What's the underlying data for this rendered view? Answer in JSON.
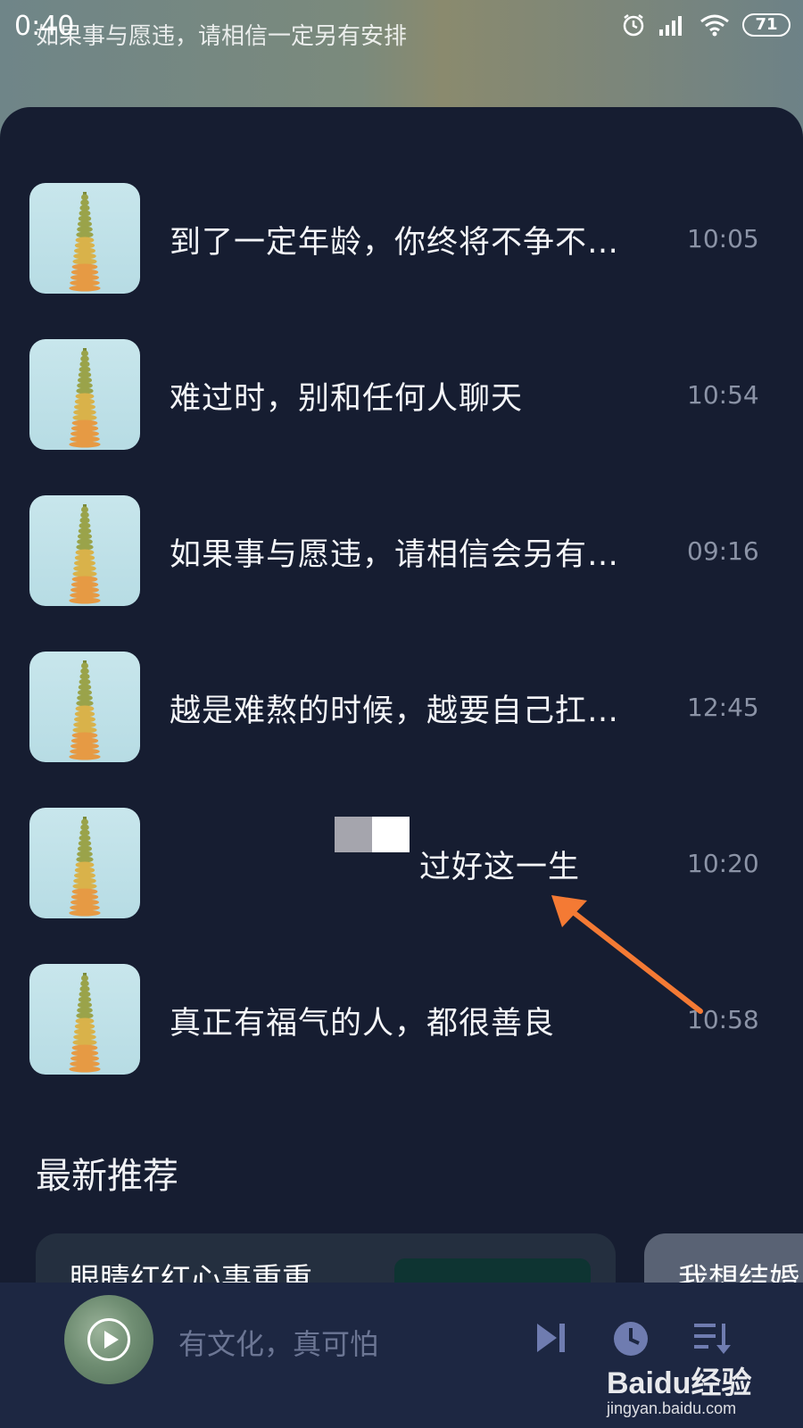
{
  "status_bar": {
    "time": "0:40",
    "now_playing": "如果事与愿违，请相信一定另有安排",
    "battery": "71",
    "icons": [
      "alarm-icon",
      "signal-icon",
      "wifi-icon",
      "battery-icon"
    ]
  },
  "playlist": [
    {
      "title": "到了一定年龄，你终将不争不…",
      "time": "10:05"
    },
    {
      "title": "难过时，别和任何人聊天",
      "time": "10:54"
    },
    {
      "title": "如果事与愿违，请相信会另有…",
      "time": "09:16"
    },
    {
      "title": "越是难熬的时候，越要自己扛…",
      "time": "12:45"
    },
    {
      "title": "过好这一生",
      "time": "10:20"
    },
    {
      "title": "真正有福气的人，都很善良",
      "time": "10:58"
    }
  ],
  "section": {
    "title": "最新推荐"
  },
  "recommendations": [
    {
      "title": "眼睛红红心事重重"
    },
    {
      "title": "我想结婚"
    }
  ],
  "player": {
    "title": "有文化，真可怕",
    "controls": [
      "next-icon",
      "timer-icon",
      "playlist-icon"
    ]
  },
  "watermark": {
    "logo": "Baidu经验",
    "url": "jingyan.baidu.com"
  },
  "colors": {
    "sheet_bg": "#161d31",
    "player_bg": "#1d2742",
    "accent_arrow": "#f47a34",
    "time_text": "#8b93a6"
  }
}
